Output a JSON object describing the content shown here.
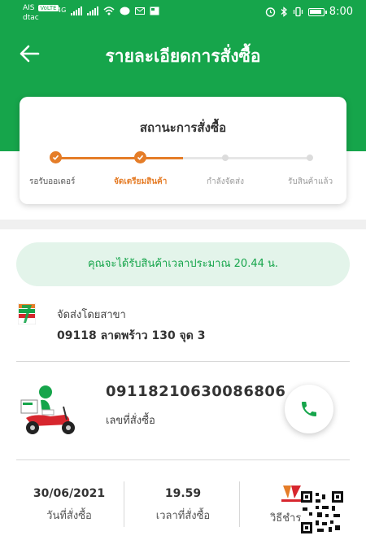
{
  "status_bar": {
    "carrier1": "AIS",
    "carrier1_badge": "VoLTE",
    "carrier2": "dtac",
    "network": "4G",
    "time": "8:00"
  },
  "header": {
    "title": "รายละเอียดการสั่งซื้อ",
    "background": "#16a54b"
  },
  "order_status": {
    "title": "สถานะการสั่งซื้อ",
    "progress": 0.5,
    "accent": "#e57d28",
    "steps": [
      {
        "label": "รอรับออเดอร์",
        "state": "done"
      },
      {
        "label": "จัดเตรียมสินค้า",
        "state": "active"
      },
      {
        "label": "กำลังจัดส่ง",
        "state": "pending"
      },
      {
        "label": "รับสินค้าแล้ว",
        "state": "pending"
      }
    ]
  },
  "eta": {
    "text": "คุณจะได้รับสินค้าเวลาประมาณ 20.44 น."
  },
  "branch": {
    "label": "จัดส่งโดยสาขา",
    "name": "09118 ลาดพร้าว 130 จุด 3",
    "logo": "seven-eleven-logo"
  },
  "order": {
    "number": "09118210630086806",
    "label": "เลขที่สั่งซื้อ",
    "call_icon": "phone-icon"
  },
  "details": {
    "date": "30/06/2021",
    "date_label": "วันที่สั่งซื้อ",
    "time": "19.59",
    "time_label": "เวลาที่สั่งซื้อ",
    "payment_label": "วิธีชำระ",
    "payment_logo": "truemoney-wallet-logo"
  }
}
